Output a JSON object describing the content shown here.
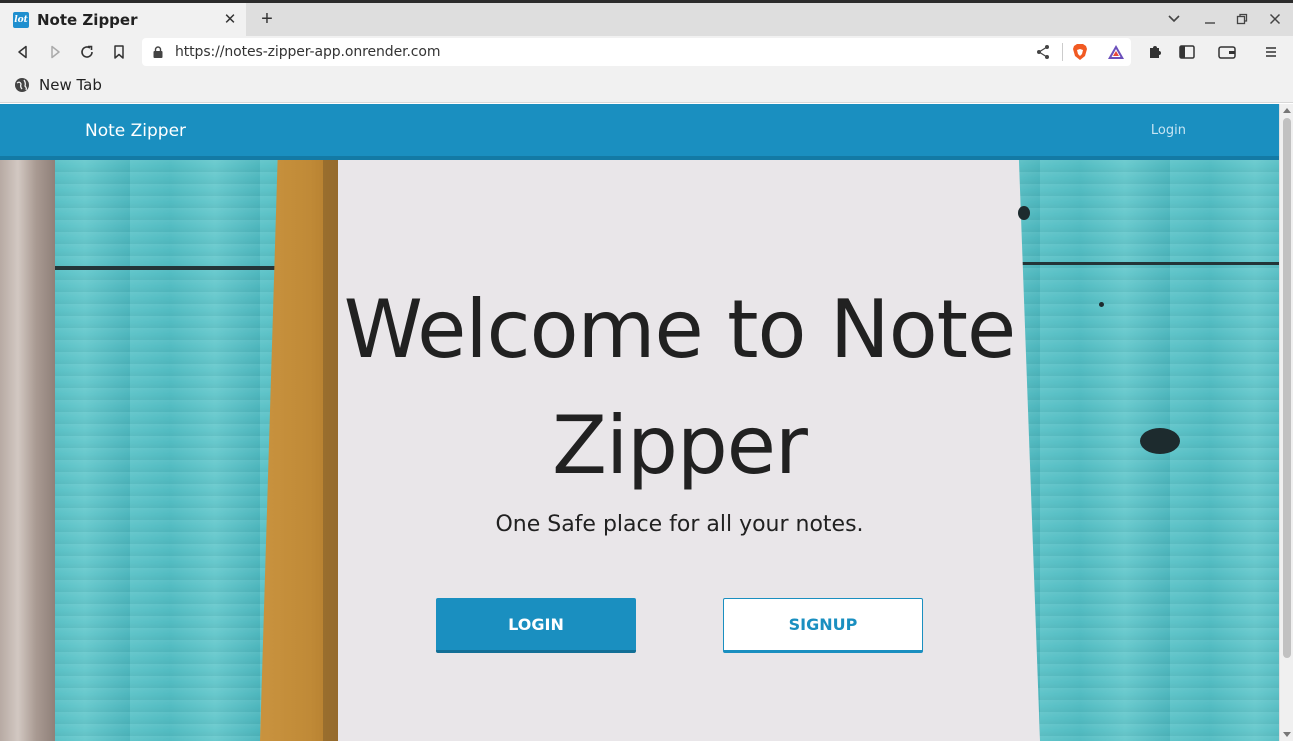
{
  "browser": {
    "tab_title": "Note Zipper",
    "tab_favicon_text": "lot",
    "tab_close": "✕",
    "new_tab": "+",
    "url": "https://notes-zipper-app.onrender.com",
    "bookmark_label": "New Tab"
  },
  "navbar": {
    "brand": "Note Zipper",
    "login_link": "Login"
  },
  "hero": {
    "title": "Welcome to Note Zipper",
    "subtitle": "One Safe place for all your notes.",
    "login_button": "LOGIN",
    "signup_button": "SIGNUP"
  },
  "colors": {
    "primary": "#1a8fc0",
    "navbar_border": "#137aa5",
    "paper": "#e9e6e9",
    "wood": "#5fc4c9",
    "text": "#212121"
  },
  "icons": [
    "back-icon",
    "forward-icon",
    "reload-icon",
    "bookmark-icon",
    "lock-icon",
    "share-icon",
    "brave-shield-icon",
    "brave-rewards-icon",
    "extensions-icon",
    "sidebar-icon",
    "wallet-icon",
    "menu-icon",
    "globe-icon"
  ]
}
